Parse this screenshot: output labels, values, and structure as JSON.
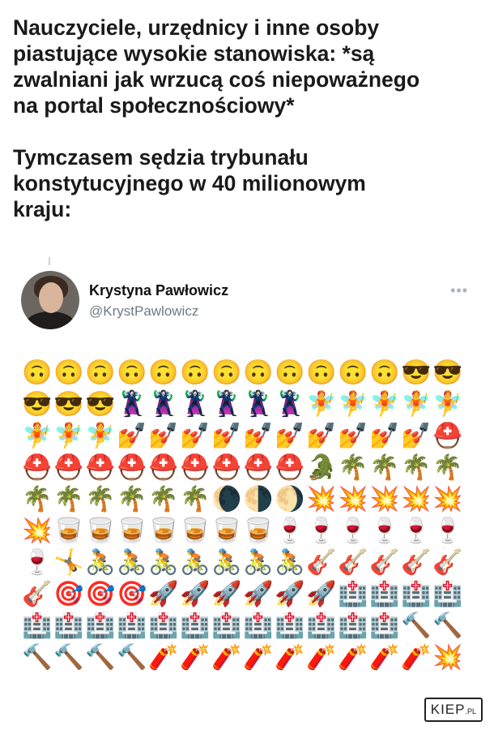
{
  "caption": {
    "line1": "Nauczyciele, urzędnicy i inne osoby\npiastujące wysokie stanowiska: *są\nzwalniani jak wrzucą coś niepoważnego\nna portal społecznościowy*",
    "line2": "Tymczasem sędzia trybunału\nkonstytucyjnego w 40 milionowym\nkraju:"
  },
  "tweet": {
    "author_name": "Krystyna Pawłowicz",
    "author_handle": "@KrystPawlowicz",
    "more": "•••",
    "emoji_rows": [
      [
        "🙃",
        "🙃",
        "🙃",
        "🙃",
        "🙃",
        "🙃",
        "🙃",
        "🙃",
        "🙃",
        "🙃",
        "🙃",
        "🙃",
        "😎",
        "😎"
      ],
      [
        "😎",
        "😎",
        "😎",
        "🦹‍♀️",
        "🦹‍♀️",
        "🦹‍♀️",
        "🦹‍♀️",
        "🦹‍♀️",
        "🦹‍♀️",
        "🧚",
        "🧚",
        "🧚",
        "🧚",
        "🧚"
      ],
      [
        "🧚",
        "🧚",
        "🧚",
        "💅",
        "💅",
        "💅",
        "💅",
        "💅",
        "💅",
        "💅",
        "💅",
        "💅",
        "💅",
        "⛑️"
      ],
      [
        "⛑️",
        "⛑️",
        "⛑️",
        "⛑️",
        "⛑️",
        "⛑️",
        "⛑️",
        "⛑️",
        "⛑️",
        "🐊",
        "🌴",
        "🌴",
        "🌴",
        "🌴"
      ],
      [
        "🌴",
        "🌴",
        "🌴",
        "🌴",
        "🌴",
        "🌴",
        "🌘",
        "🌗",
        "🌖",
        "💥",
        "💥",
        "💥",
        "💥",
        "💥"
      ],
      [
        "💥",
        "🥃",
        "🥃",
        "🥃",
        "🥃",
        "🥃",
        "🥃",
        "🥃",
        "🍷",
        "🍷",
        "🍷",
        "🍷",
        "🍷",
        "🍷"
      ],
      [
        "🍷",
        "🤸",
        "🚴",
        "🚴",
        "🚴",
        "🚴",
        "🚴",
        "🚴",
        "🚴",
        "🎸",
        "🎸",
        "🎸",
        "🎸",
        "🎸"
      ],
      [
        "🎸",
        "🎯",
        "🎯",
        "🎯",
        "🚀",
        "🚀",
        "🚀",
        "🚀",
        "🚀",
        "🚀",
        "🏥",
        "🏥",
        "🏥",
        "🏥"
      ],
      [
        "🏥",
        "🏥",
        "🏥",
        "🏥",
        "🏥",
        "🏥",
        "🏥",
        "🏥",
        "🏥",
        "🏥",
        "🏥",
        "🏥",
        "🔨",
        "🔨"
      ],
      [
        "🔨",
        "🔨",
        "🔨",
        "🔨",
        "🧨",
        "🧨",
        "🧨",
        "🧨",
        "🧨",
        "🧨",
        "🧨",
        "🧨",
        "🧨",
        "💥"
      ]
    ]
  },
  "watermark": {
    "main": "KIEP",
    "suffix": ".PL"
  }
}
